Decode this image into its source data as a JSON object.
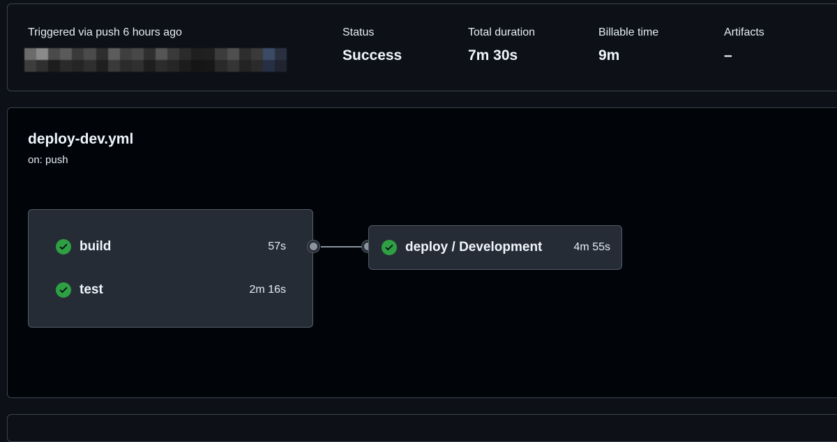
{
  "summary": {
    "trigger_text": "Triggered via push 6 hours ago",
    "redacted_commit_colors": [
      "#6b6b6b",
      "#8a8a8a",
      "#4a4a4a",
      "#5a5a5a",
      "#3a3a3a",
      "#4b4b4b",
      "#2e2e2e",
      "#5c5c5c",
      "#3f3f3f",
      "#484848",
      "#2f2f2f",
      "#555555",
      "#3a3a3a",
      "#2b2b2b",
      "#1f1f1f",
      "#202020",
      "#3c3c3c",
      "#4f4f4f",
      "#2d2d2d",
      "#3a3a3a",
      "#3b4b66",
      "#2a3040",
      "#3d3d3d",
      "#2f2f2f",
      "#1d1d1d",
      "#2a2a2a",
      "#252525",
      "#2f2f2f",
      "#1f1f1f",
      "#3a3a3a",
      "#2b2b2b",
      "#303030",
      "#1e1e1e",
      "#2c2c2c",
      "#262626",
      "#1c1c1c",
      "#151515",
      "#171717",
      "#2a2a2a",
      "#353535",
      "#232323",
      "#2b2b2b",
      "#263045",
      "#1f2430"
    ],
    "stats": [
      {
        "label": "Status",
        "value": "Success"
      },
      {
        "label": "Total duration",
        "value": "7m 30s"
      },
      {
        "label": "Billable time",
        "value": "9m"
      },
      {
        "label": "Artifacts",
        "value": "–"
      }
    ]
  },
  "workflow": {
    "file_name": "deploy-dev.yml",
    "trigger": "on: push",
    "jobs": [
      {
        "name": "build",
        "duration": "57s",
        "status": "success"
      },
      {
        "name": "test",
        "duration": "2m 16s",
        "status": "success"
      }
    ],
    "downstream_job": {
      "name": "deploy / Development",
      "duration": "4m 55s",
      "status": "success"
    },
    "success_color": "#2ea043",
    "status_icon": "check-circle-icon"
  }
}
